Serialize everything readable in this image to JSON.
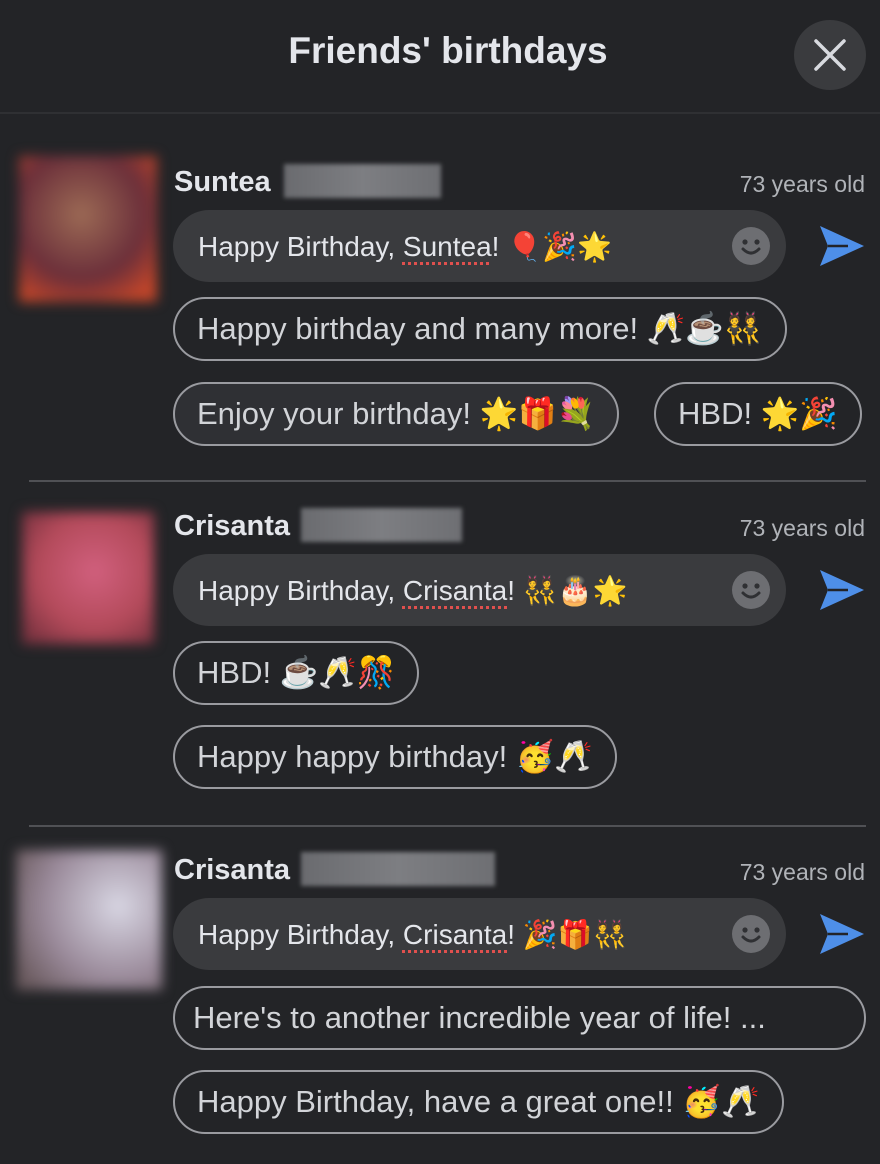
{
  "header": {
    "title": "Friends' birthdays",
    "close_icon": "close-icon"
  },
  "colors": {
    "background": "#232427",
    "send_accent": "#4e8fe8",
    "spellcheck": "#e0504e"
  },
  "friends": [
    {
      "name": "Suntea",
      "age": "73 years old",
      "message_prefix": "Happy Birthday, ",
      "message_name": "Suntea",
      "message_suffix": "! 🎈🎉🌟",
      "suggestions": [
        "Happy birthday and many more! 🥂☕👯",
        "Enjoy your birthday! 🌟🎁💐",
        "HBD! 🌟🎉"
      ]
    },
    {
      "name": "Crisanta",
      "age": "73 years old",
      "message_prefix": "Happy Birthday, ",
      "message_name": "Crisanta",
      "message_suffix": "! 👯🎂🌟",
      "suggestions": [
        "HBD! ☕🥂🎊",
        "Happy happy birthday! 🥳🥂"
      ]
    },
    {
      "name": "Crisanta",
      "age": "73 years old",
      "message_prefix": "Happy Birthday, ",
      "message_name": "Crisanta",
      "message_suffix": "! 🎉🎁👯",
      "suggestions": [
        "Here's to another incredible year of life! ...",
        "Happy Birthday, have a great one!! 🥳🥂"
      ]
    }
  ]
}
